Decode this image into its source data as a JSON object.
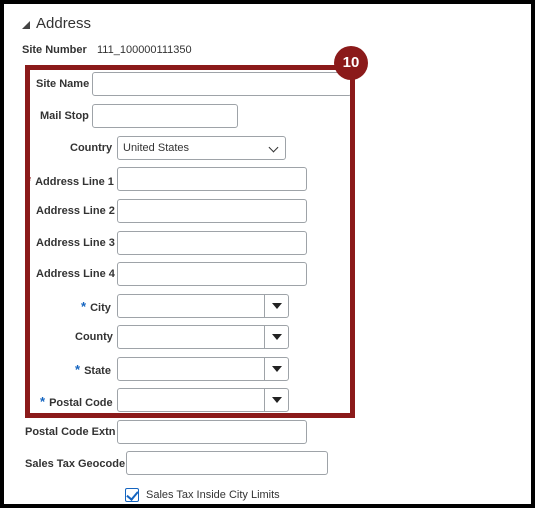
{
  "section": {
    "title": "Address"
  },
  "site_number": {
    "label": "Site Number",
    "value": "111_100000111350"
  },
  "callout": {
    "number": "10"
  },
  "fields": {
    "site_name": {
      "label": "Site Name",
      "value": ""
    },
    "mail_stop": {
      "label": "Mail Stop",
      "value": ""
    },
    "country": {
      "label": "Country",
      "value": "United States"
    },
    "address_line_1": {
      "label": "Address Line 1",
      "required_marker": "*",
      "value": ""
    },
    "address_line_2": {
      "label": "Address Line 2",
      "value": ""
    },
    "address_line_3": {
      "label": "Address Line 3",
      "value": ""
    },
    "address_line_4": {
      "label": "Address Line 4",
      "value": ""
    },
    "city": {
      "label": "City",
      "required_marker": "*",
      "value": ""
    },
    "county": {
      "label": "County",
      "value": ""
    },
    "state": {
      "label": "State",
      "required_marker": "*",
      "value": ""
    },
    "postal_code": {
      "label": "Postal Code",
      "required_marker": "*",
      "value": ""
    },
    "postal_code_extn": {
      "label": "Postal Code Extn",
      "value": ""
    },
    "sales_tax_geocode": {
      "label": "Sales Tax Geocode",
      "value": ""
    },
    "sales_tax_inside_city_limits": {
      "label": "Sales Tax Inside City Limits",
      "checked": true
    }
  },
  "colors": {
    "callout": "#8b1a1a",
    "required": "#1565c0",
    "frame": "#000000"
  },
  "icons": {
    "collapse": "collapse-triangle-icon",
    "dropdown": "dropdown-arrow-icon",
    "check": "checkmark-icon"
  }
}
